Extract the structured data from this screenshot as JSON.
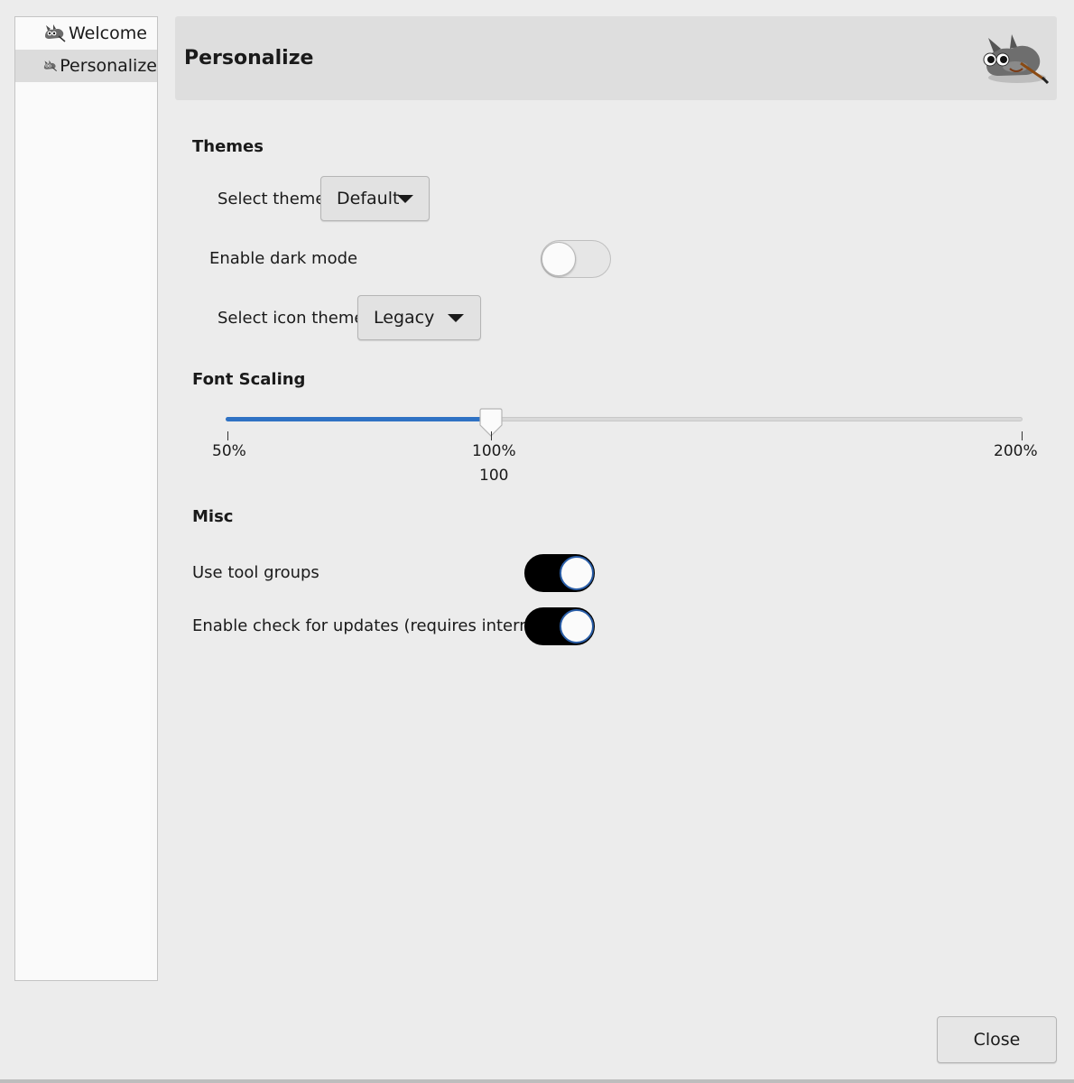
{
  "sidebar": {
    "items": [
      {
        "label": "Welcome",
        "icon": "gimp-mascot-icon",
        "selected": false
      },
      {
        "label": "Personalize",
        "icon": "gimp-mascot-icon",
        "selected": true
      }
    ]
  },
  "header": {
    "title": "Personalize",
    "logo": "gimp-wilber-logo"
  },
  "themes": {
    "section_title": "Themes",
    "select_theme_label": "Select theme",
    "select_theme_value": "Default",
    "dark_mode_label": "Enable dark mode",
    "dark_mode_on": false,
    "icon_theme_label": "Select icon theme",
    "icon_theme_value": "Legacy"
  },
  "font_scaling": {
    "section_title": "Font Scaling",
    "min_label": "50%",
    "mid_label": "100%",
    "max_label": "200%",
    "min": 50,
    "max": 200,
    "value": 100,
    "value_label": "100"
  },
  "misc": {
    "section_title": "Misc",
    "tool_groups_label": "Use tool groups",
    "tool_groups_on": true,
    "updates_label": "Enable check for updates (requires internet)",
    "updates_on": true
  },
  "footer": {
    "close_label": "Close"
  },
  "colors": {
    "accent": "#2f72c4",
    "switch_on": "#000000",
    "background": "#ececec"
  }
}
